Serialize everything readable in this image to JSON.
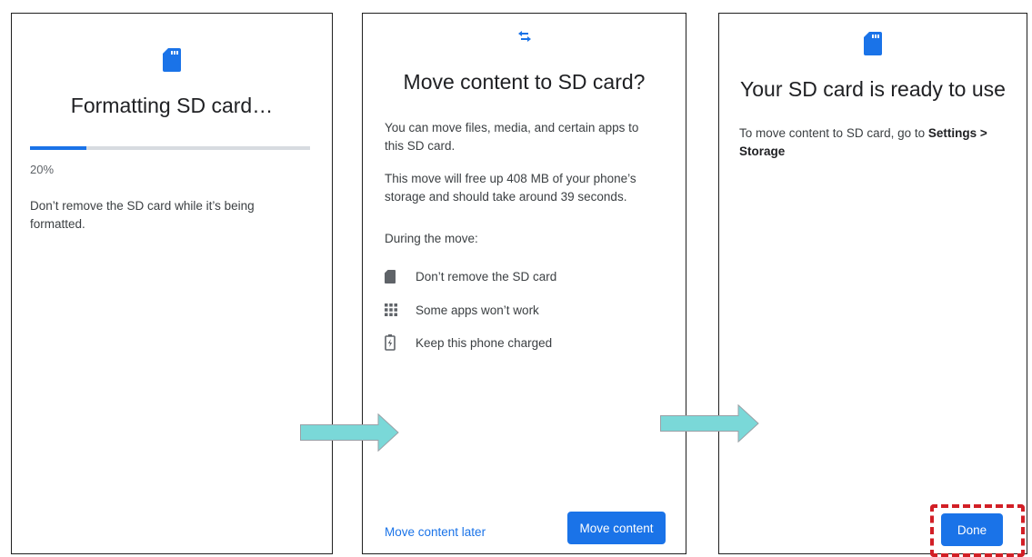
{
  "screen1": {
    "title": "Formatting SD card…",
    "progress_percent": 20,
    "progress_label": "20%",
    "message": "Don’t remove the SD card while it’s being formatted.",
    "icon": "sd-card-icon"
  },
  "screen2": {
    "icon": "swap-arrows-icon",
    "title": "Move content to SD card?",
    "intro": "You can move files, media, and certain apps to this SD card.",
    "details": "This move will free up 408 MB of your phone’s storage and should take around 39 seconds.",
    "during_label": "During the move:",
    "items": [
      {
        "icon": "sd-card-icon",
        "label": "Don’t remove the SD card"
      },
      {
        "icon": "apps-grid-icon",
        "label": "Some apps won’t work"
      },
      {
        "icon": "battery-charging-icon",
        "label": "Keep this phone charged"
      }
    ],
    "later_button": "Move content later",
    "move_button": "Move content"
  },
  "screen3": {
    "icon": "sd-card-icon",
    "title": "Your SD card is ready to use",
    "message_prefix": "To move content to SD card, go to ",
    "message_bold": "Settings > Storage",
    "done_button": "Done"
  },
  "colors": {
    "accent": "#1a73e8",
    "highlight": "#d21f26",
    "arrow": "#7ad8d8"
  }
}
